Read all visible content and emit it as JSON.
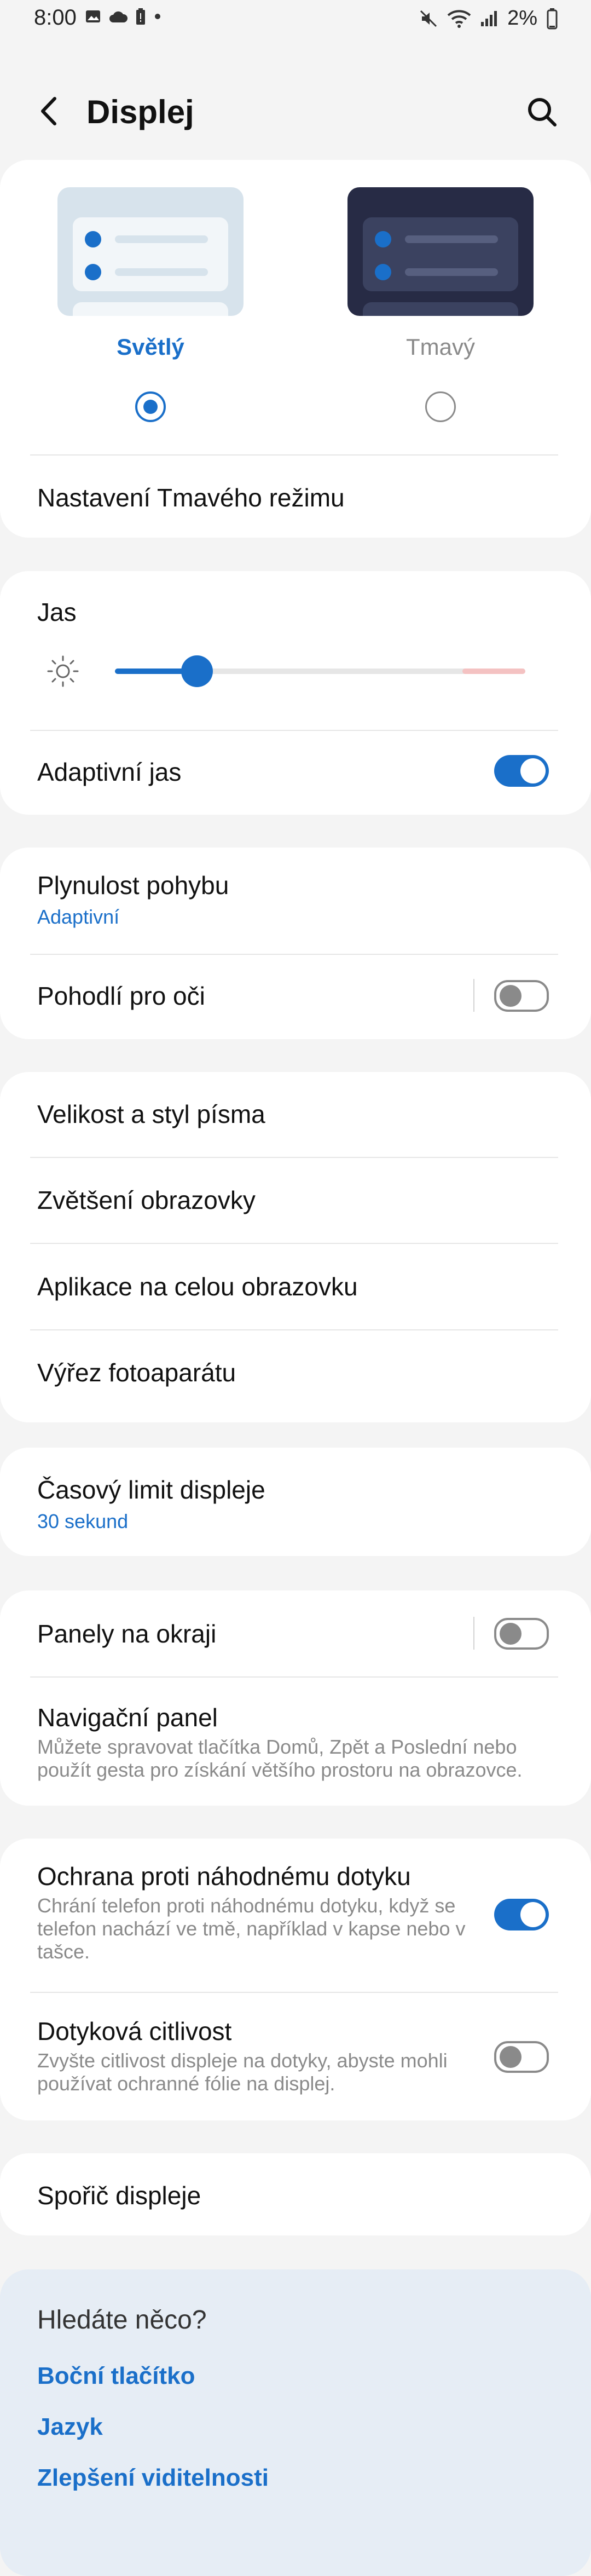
{
  "status_bar": {
    "time": "8:00",
    "battery": "2%"
  },
  "header": {
    "title": "Displej"
  },
  "theme": {
    "light_label": "Světlý",
    "dark_label": "Tmavý",
    "selected": "light",
    "dark_mode_settings": "Nastavení Tmavého režimu"
  },
  "brightness": {
    "title": "Jas",
    "level": 0.2,
    "adaptive_label": "Adaptivní jas",
    "adaptive_on": true
  },
  "motion": {
    "smoothness_title": "Plynulost pohybu",
    "smoothness_value": "Adaptivní",
    "eye_comfort": "Pohodlí pro oči",
    "eye_comfort_on": false
  },
  "font_group": {
    "items": [
      "Velikost a styl písma",
      "Zvětšení obrazovky",
      "Aplikace na celou obrazovku",
      "Výřez fotoaparátu"
    ]
  },
  "timeout": {
    "title": "Časový limit displeje",
    "value": "30 sekund"
  },
  "panels": {
    "edge_title": "Panely na okraji",
    "edge_on": false,
    "nav_title": "Navigační panel",
    "nav_desc": "Můžete spravovat tlačítka Domů, Zpět a Poslední nebo použít gesta pro získání většího prostoru na obrazovce."
  },
  "touch": {
    "accidental_title": "Ochrana proti náhodnému dotyku",
    "accidental_desc": "Chrání telefon proti náhodnému dotyku, když se telefon nachází ve tmě, například v kapse nebo v tašce.",
    "accidental_on": true,
    "sensitivity_title": "Dotyková citlivost",
    "sensitivity_desc": "Zvyšte citlivost displeje na dotyky, abyste mohli používat ochranné fólie na displej.",
    "sensitivity_on": false
  },
  "screensaver": {
    "title": "Spořič displeje"
  },
  "suggestions": {
    "title": "Hledáte něco?",
    "links": [
      "Boční tlačítko",
      "Jazyk",
      "Zlepšení viditelnosti"
    ]
  },
  "colors": {
    "accent": "#1a6fc9",
    "background": "#f4f4f4",
    "card": "#ffffff",
    "suggest_bg": "#e6edf5",
    "dark_preview": "#272b45",
    "light_preview": "#d7e3ec"
  }
}
